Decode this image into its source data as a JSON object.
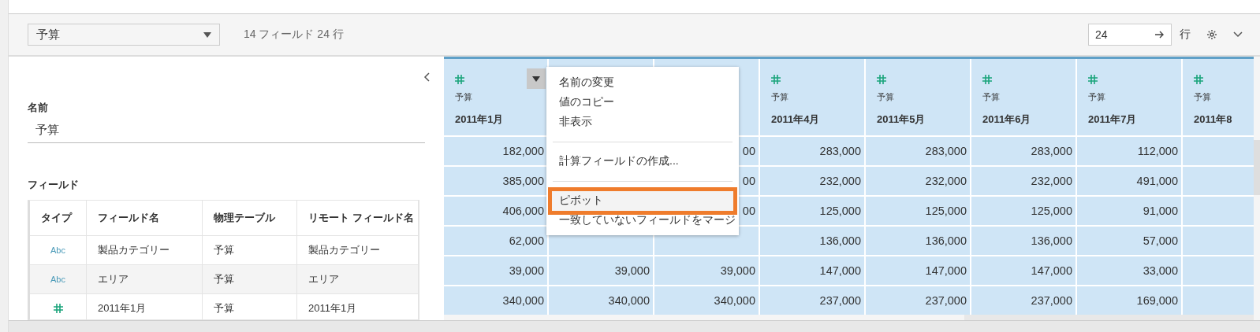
{
  "toolbar": {
    "table_select": "予算",
    "summary": "14 フィールド 24 行",
    "rows_input": "24",
    "rows_label": "行"
  },
  "details": {
    "name_label": "名前",
    "name_value": "予算",
    "fields_label": "フィールド",
    "columns": [
      "タイプ",
      "フィールド名",
      "物理テーブル",
      "リモート フィールド名"
    ],
    "rows": [
      {
        "kind": "string",
        "type_text": "Abc",
        "name": "製品カテゴリー",
        "table": "予算",
        "remote": "製品カテゴリー"
      },
      {
        "kind": "string",
        "type_text": "Abc",
        "name": "エリア",
        "table": "予算",
        "remote": "エリア"
      },
      {
        "kind": "number",
        "name": "2011年1月",
        "table": "予算",
        "remote": "2011年1月"
      }
    ]
  },
  "grid": {
    "columns": [
      {
        "kind": "number",
        "source": "予算",
        "name": "2011年1月",
        "menu_open": true,
        "cells": [
          {
            "kind": "value",
            "text": "182,000"
          },
          {
            "kind": "value",
            "text": "385,000"
          },
          {
            "kind": "value",
            "text": "406,000"
          },
          {
            "kind": "value",
            "text": "62,000"
          },
          {
            "kind": "value",
            "text": "39,000"
          },
          {
            "kind": "value",
            "text": "340,000"
          }
        ]
      },
      {
        "cells": [
          {
            "kind": "blank"
          },
          {
            "kind": "value",
            "text": "39,000"
          },
          {
            "kind": "value",
            "text": "340,000"
          }
        ]
      },
      {
        "cells": [
          {
            "kind": "value",
            "text": "00"
          },
          {
            "kind": "value",
            "text": "00"
          },
          {
            "kind": "value",
            "text": "00"
          },
          {
            "kind": "blank"
          },
          {
            "kind": "value",
            "text": "39,000"
          },
          {
            "kind": "value",
            "text": "340,000"
          }
        ]
      },
      {
        "kind": "number",
        "source": "予算",
        "name": "2011年4月",
        "cells": [
          {
            "kind": "value",
            "text": "283,000"
          },
          {
            "kind": "value",
            "text": "232,000"
          },
          {
            "kind": "value",
            "text": "125,000"
          },
          {
            "kind": "value",
            "text": "136,000"
          },
          {
            "kind": "value",
            "text": "147,000"
          },
          {
            "kind": "value",
            "text": "237,000"
          }
        ]
      },
      {
        "kind": "number",
        "source": "予算",
        "name": "2011年5月",
        "cells": [
          {
            "kind": "value",
            "text": "283,000"
          },
          {
            "kind": "value",
            "text": "232,000"
          },
          {
            "kind": "value",
            "text": "125,000"
          },
          {
            "kind": "value",
            "text": "136,000"
          },
          {
            "kind": "value",
            "text": "147,000"
          },
          {
            "kind": "value",
            "text": "237,000"
          }
        ]
      },
      {
        "kind": "number",
        "source": "予算",
        "name": "2011年6月",
        "cells": [
          {
            "kind": "value",
            "text": "283,000"
          },
          {
            "kind": "value",
            "text": "232,000"
          },
          {
            "kind": "value",
            "text": "125,000"
          },
          {
            "kind": "value",
            "text": "136,000"
          },
          {
            "kind": "value",
            "text": "147,000"
          },
          {
            "kind": "value",
            "text": "237,000"
          }
        ]
      },
      {
        "kind": "number",
        "source": "予算",
        "name": "2011年7月",
        "cells": [
          {
            "kind": "value",
            "text": "112,000"
          },
          {
            "kind": "value",
            "text": "491,000"
          },
          {
            "kind": "value",
            "text": "91,000"
          },
          {
            "kind": "value",
            "text": "57,000"
          },
          {
            "kind": "value",
            "text": "33,000"
          },
          {
            "kind": "value",
            "text": "169,000"
          }
        ]
      },
      {
        "kind": "number",
        "source": "予算",
        "name": "2011年8",
        "cells": [
          {
            "kind": "blank"
          },
          {
            "kind": "blank"
          },
          {
            "kind": "blank"
          },
          {
            "kind": "blank"
          },
          {
            "kind": "blank"
          },
          {
            "kind": "blank"
          }
        ]
      }
    ]
  },
  "menu": {
    "items": [
      {
        "kind": "item",
        "label": "名前の変更",
        "selected": false
      },
      {
        "kind": "item",
        "label": "値のコピー",
        "selected": false
      },
      {
        "kind": "item",
        "label": "非表示",
        "selected": false
      },
      {
        "kind": "separator"
      },
      {
        "kind": "item",
        "label": "計算フィールドの作成...",
        "selected": false
      },
      {
        "kind": "separator"
      },
      {
        "kind": "item",
        "label": "ピボット",
        "selected": true
      },
      {
        "kind": "item",
        "label": "一致していないフィールドをマージ",
        "selected": false
      }
    ]
  }
}
